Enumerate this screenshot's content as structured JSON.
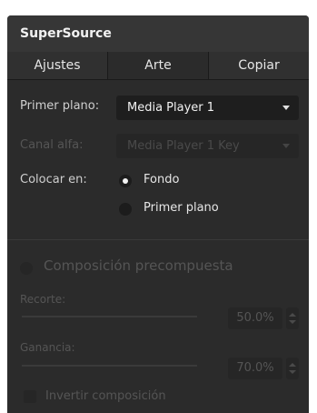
{
  "panel": {
    "title": "SuperSource",
    "tabs": [
      "Ajustes",
      "Arte",
      "Copiar"
    ],
    "active_tab": "Arte"
  },
  "art": {
    "foreground_label": "Primer plano:",
    "foreground_value": "Media Player 1",
    "key_label": "Canal alfa:",
    "key_value": "Media Player 1 Key",
    "place_label": "Colocar en:",
    "place_options": [
      "Fondo",
      "Primer plano"
    ],
    "place_selected": "Fondo"
  },
  "premult": {
    "label": "Composición precompuesta",
    "clip_label": "Recorte:",
    "clip_value": "50.0%",
    "gain_label": "Ganancia:",
    "gain_value": "70.0%",
    "invert_label": "Invertir composición"
  }
}
